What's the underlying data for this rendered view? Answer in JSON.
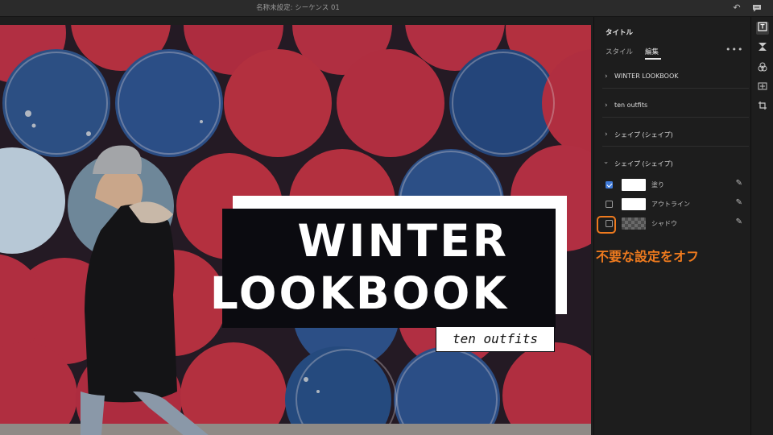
{
  "app": {
    "sequence_title": "名称未設定: シーケンス 01",
    "icons": {
      "undo": "undo-icon",
      "feedback": "feedback-icon"
    }
  },
  "video": {
    "title_line1": "WINTER",
    "title_line2": "LOOKBOOK",
    "subtitle": "ten outfits"
  },
  "panel": {
    "heading": "タイトル",
    "tabs": [
      {
        "label": "スタイル",
        "active": false
      },
      {
        "label": "編集",
        "active": true
      }
    ],
    "more_label": "•••",
    "sections": [
      {
        "label": "WINTER LOOKBOOK",
        "expanded": false
      },
      {
        "label": "ten outfits",
        "expanded": false
      },
      {
        "label": "シェイプ (シェイプ)",
        "expanded": false
      },
      {
        "label": "シェイプ (シェイプ)",
        "expanded": true
      }
    ],
    "properties": [
      {
        "label": "塗り",
        "checked": true,
        "swatch": "#ffffff"
      },
      {
        "label": "アウトライン",
        "checked": false,
        "swatch": "#ffffff"
      },
      {
        "label": "シャドウ",
        "checked": false,
        "swatch": "transparent"
      }
    ]
  },
  "annotation": {
    "text": "不要な設定をオフ",
    "color": "#ee7a1e"
  },
  "toolstrip": [
    {
      "icon": "essential-graphics-icon",
      "active": true
    },
    {
      "icon": "transitions-icon",
      "active": false
    },
    {
      "icon": "color-icon",
      "active": false
    },
    {
      "icon": "audio-icon",
      "active": false
    },
    {
      "icon": "crop-icon",
      "active": false
    }
  ]
}
